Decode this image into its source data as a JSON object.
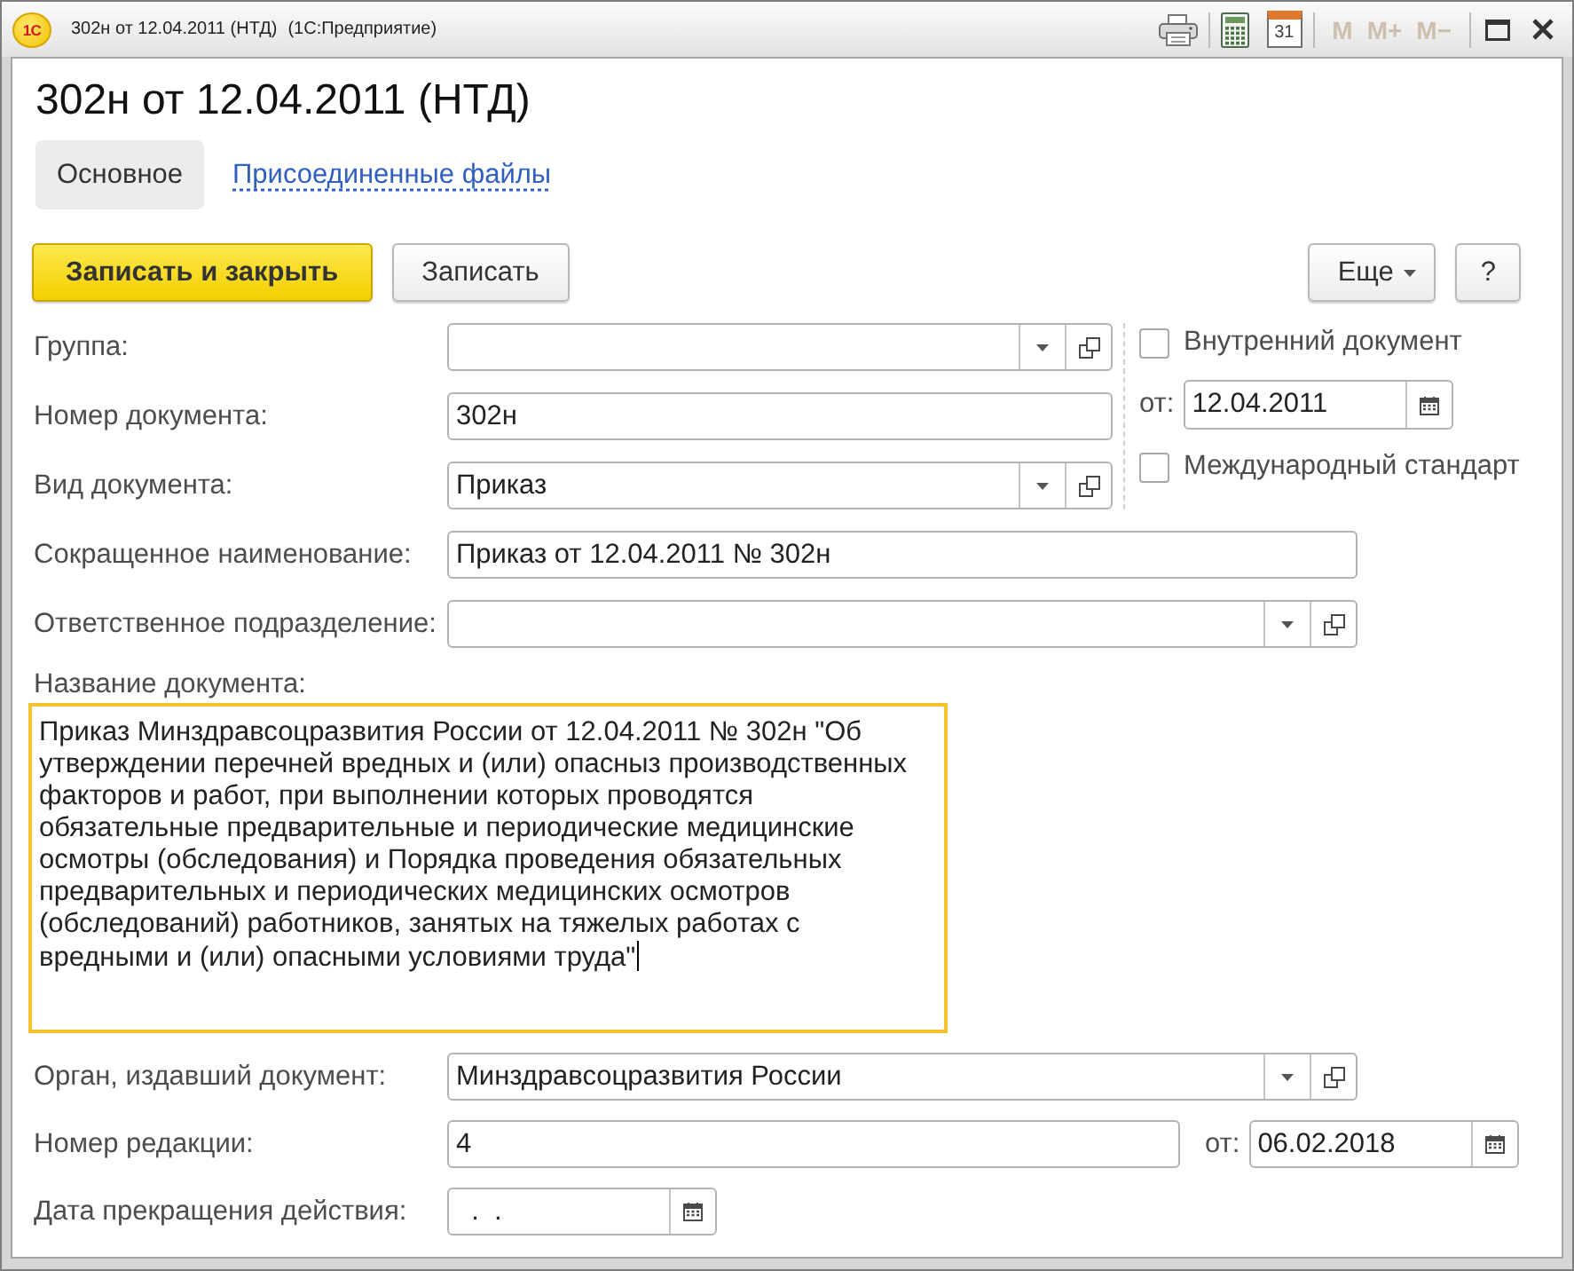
{
  "window": {
    "logo": "1С",
    "title": "302н от 12.04.2011 (НТД)",
    "app_name": "(1С:Предприятие)",
    "toolbar": [
      {
        "kind": "print"
      },
      {
        "kind": "calculator"
      },
      {
        "kind": "calendar",
        "label": "31"
      },
      {
        "kind": "memory",
        "label": "M",
        "disabled": true
      },
      {
        "kind": "memory",
        "label": "M+",
        "disabled": true
      },
      {
        "kind": "memory",
        "label": "M−",
        "disabled": true
      },
      {
        "kind": "maximize"
      },
      {
        "kind": "close"
      }
    ]
  },
  "heading": "302н от 12.04.2011 (НТД)",
  "tabs": [
    {
      "label": "Основное",
      "selected": true
    },
    {
      "label": "Присоединенные файлы",
      "selected": false
    }
  ],
  "commands": {
    "left": [
      {
        "kind": "primary",
        "label": "Записать и закрыть"
      },
      {
        "kind": "normal",
        "label": "Записать"
      }
    ],
    "right": [
      {
        "kind": "menu",
        "label": "Еще"
      },
      {
        "kind": "help",
        "label": "?"
      }
    ]
  },
  "top_fields": [
    {
      "label": "Группа:",
      "kind": "select"
    },
    {
      "label": "Номер документа:",
      "kind": "text",
      "value": "302н"
    },
    {
      "label": "Вид документа:",
      "kind": "select",
      "value": "Приказ"
    }
  ],
  "side": [
    {
      "kind": "checkbox",
      "label": "Внутренний документ",
      "checked": false
    },
    {
      "kind": "date",
      "label": "от:",
      "value": "12.04.2011"
    },
    {
      "kind": "checkbox",
      "label": "Международный стандарт",
      "checked": false
    }
  ],
  "fields": [
    {
      "label": "Сокращенное наименование:",
      "kind": "text",
      "value": "Приказ от 12.04.2011 № 302н"
    },
    {
      "label": "Ответственное подразделение:",
      "kind": "select"
    }
  ],
  "document_name": {
    "label": "Название документа:",
    "value": "Приказ Минздравсоцразвития России от 12.04.2011 № 302н \"Об утверждении перечней вредных и (или) опасныз производственных факторов и работ, при выполнении которых проводятся обязательные предварительные и периодические медицинские осмотры (обследования) и Порядка проведения обязательных предварительных и периодических медицинских осмотров (обследований) работников, занятых на тяжелых работах с вредными и (или) опасными условиями труда\"",
    "focused": true
  },
  "bottom_fields": [
    {
      "label": "Орган, издавший документ:",
      "kind": "select",
      "value": "Минздравсоцразвития России"
    },
    {
      "label": "Номер редакции:",
      "kind": "text",
      "value": "4",
      "date": {
        "label": "от:",
        "value": "06.02.2018"
      }
    },
    {
      "label": "Дата прекращения действия:",
      "kind": "date",
      "value": "  .  ."
    }
  ]
}
